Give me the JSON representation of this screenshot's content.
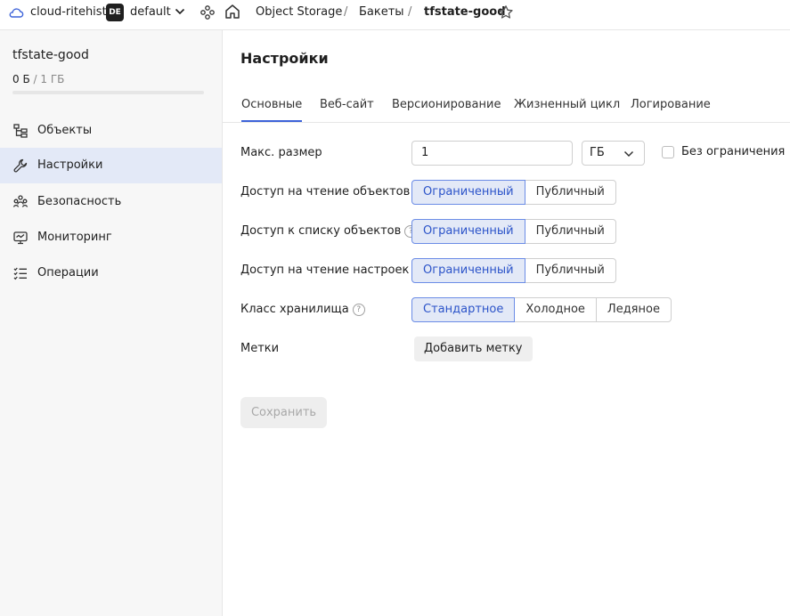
{
  "topbar": {
    "cloud_name": "cloud-ritehist",
    "folder_badge": "DE",
    "folder_name": "default",
    "service": "Object Storage",
    "sep": "/",
    "section": "Бакеты",
    "bucket": "tfstate-good"
  },
  "sidebar": {
    "bucket_name": "tfstate-good",
    "usage_used": "0 Б",
    "usage_sep": "/",
    "usage_total": "1 ГБ",
    "usage_fraction": 0,
    "items": [
      {
        "label": "Объекты",
        "icon": "objects-icon",
        "active": false
      },
      {
        "label": "Настройки",
        "icon": "wrench-icon",
        "active": true
      },
      {
        "label": "Безопасность",
        "icon": "users-icon",
        "active": false
      },
      {
        "label": "Мониторинг",
        "icon": "monitor-icon",
        "active": false
      },
      {
        "label": "Операции",
        "icon": "list-icon",
        "active": false
      }
    ]
  },
  "main": {
    "title": "Настройки",
    "tabs": [
      "Основные",
      "Веб-сайт",
      "Версионирование",
      "Жизненный цикл",
      "Логирование"
    ],
    "active_tab": 0,
    "max_size": {
      "label": "Макс. размер",
      "value": "1",
      "unit": "ГБ",
      "no_limit_label": "Без ограничения",
      "no_limit_checked": false
    },
    "read_access": {
      "label": "Доступ на чтение объектов",
      "help": "?",
      "options": [
        "Ограниченный",
        "Публичный"
      ],
      "selected": 0
    },
    "list_access": {
      "label": "Доступ к списку объектов",
      "help": "?",
      "options": [
        "Ограниченный",
        "Публичный"
      ],
      "selected": 0
    },
    "settings_access": {
      "label": "Доступ на чтение настроек",
      "help": "?",
      "options": [
        "Ограниченный",
        "Публичный"
      ],
      "selected": 0
    },
    "storage_class": {
      "label": "Класс хранилища",
      "help": "?",
      "options": [
        "Стандартное",
        "Холодное",
        "Ледяное"
      ],
      "selected": 0
    },
    "tags": {
      "label": "Метки",
      "add_button": "Добавить метку"
    },
    "save_button": "Сохранить"
  },
  "colors": {
    "accent": "#3d63d9",
    "selected_bg": "#e3e9f7",
    "sidebar_bg": "#f7f7f7"
  }
}
